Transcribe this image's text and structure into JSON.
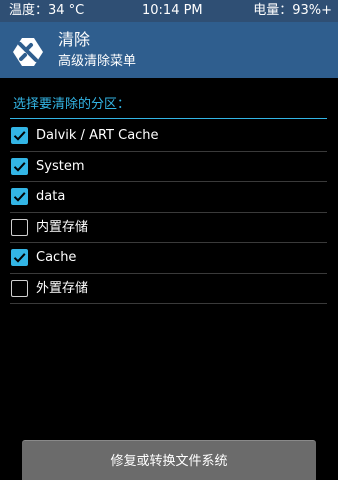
{
  "status_bar": {
    "temperature": "温度：34 °C",
    "time": "10:14 PM",
    "battery": "电量：93%+"
  },
  "header": {
    "logo_icon": "twrp-logo-icon",
    "title": "清除",
    "subtitle": "高级清除菜单"
  },
  "section": {
    "label": "选择要清除的分区："
  },
  "partitions": [
    {
      "label": "Dalvik / ART Cache",
      "checked": true
    },
    {
      "label": "System",
      "checked": true
    },
    {
      "label": "data",
      "checked": true
    },
    {
      "label": "内置存储",
      "checked": false
    },
    {
      "label": "Cache",
      "checked": true
    },
    {
      "label": "外置存储",
      "checked": false
    }
  ],
  "action": {
    "label": "修复或转换文件系统"
  },
  "colors": {
    "status_bar_bg": "#2f4f74",
    "header_bg": "#2f5e8e",
    "accent": "#33b5e5",
    "background": "#000000",
    "button_bg": "#6b6b6b"
  }
}
